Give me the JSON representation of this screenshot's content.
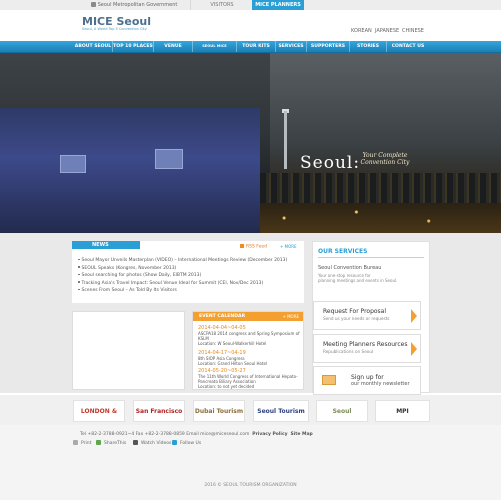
{
  "topbar": {
    "tabs": [
      {
        "label": "Seoul Metropolitan Government"
      },
      {
        "label": "VISITORS"
      },
      {
        "label": "MICE PLANNERS"
      }
    ]
  },
  "brand": {
    "name": "MICE Seoul",
    "tagline": "Seoul, A World Top 5 Convention City"
  },
  "languages": [
    "KOREAN",
    "JAPANESE",
    "CHINESE"
  ],
  "nav": {
    "items": [
      "ABOUT SEOUL",
      "TOP 10 PLACES",
      "VENUE FINDER",
      "SEOUL MICE ALLIANCE",
      "TOUR KITS",
      "SERVICES",
      "SUPPORTERS",
      "STORIES",
      "CONTACT US"
    ]
  },
  "hero": {
    "title": "Seoul:",
    "subtitle": "Your Complete Convention City"
  },
  "news": {
    "tab": "NEWS",
    "rss": "RSS Feed",
    "more": "+ MORE",
    "items": [
      "Seoul Mayor Unveils Masterplan (VIDEO) – International Meetings Review (December 2013)",
      "SEOUL Speaks (Kongres, November 2013)",
      "Seoul searching for photos (Show Daily, EIBTM 2013)",
      "Tracking Asia's Travel Impact: Seoul Venue Ideal for Summit (CEI, Nov/Dec 2013)",
      "Scenes From Seoul – As Told By Its Visitors"
    ]
  },
  "calendar": {
    "title": "EVENT CALENDAR",
    "more": "+ MORE",
    "events": [
      {
        "date": "2014-04-04~04-05",
        "lines": [
          "ASCPA18 2014 congress and Spring Symposium of KSLM",
          "Location: W Seoul-Walkerhill Hotel"
        ]
      },
      {
        "date": "2014-04-17~04-19",
        "lines": [
          "8th SIOP Asia Congress",
          "Location: Grand Hilton Seoul Hotel"
        ]
      },
      {
        "date": "2014-05-20~05-27",
        "lines": [
          "The 11th World Congress of International Hepato-Pancreato Biliary Association",
          "Location: to not yet decided"
        ]
      }
    ]
  },
  "services": {
    "heading": "OUR SERVICES",
    "bureau": "Seoul Convention Bureau",
    "desc": [
      "Your one-stop resource for",
      "planning meetings and events in Seoul."
    ],
    "buttons": [
      {
        "title": "Request For Proposal",
        "sub": "Send us your needs or requests"
      },
      {
        "title": "Meeting Planners Resources",
        "sub": "Republications on Seoul"
      },
      {
        "title": "Sign up for",
        "sub": "our monthly newsletter"
      }
    ]
  },
  "partners": [
    "LONDON & PARTNERS",
    "San Francisco Travel",
    "Dubai Tourism",
    "Seoul Tourism Organization",
    "Seoul",
    "MPI"
  ],
  "footer": {
    "contact": "Tel +82-2-3788-0921~4  Fax +82-2-3788-0859  Email  mice@miceseoul.com",
    "privacy": "Privacy Policy",
    "sitemap": "Site Map",
    "actions": [
      "Print",
      "ShareThis",
      "Watch Videos",
      "Follow Us"
    ],
    "copyright": "2016 © SEOUL TOURISM ORGANIZATION"
  },
  "colors": {
    "accent_blue": "#2a9fd6",
    "accent_orange": "#f3a030",
    "brand_blue": "#4d6f8e"
  }
}
